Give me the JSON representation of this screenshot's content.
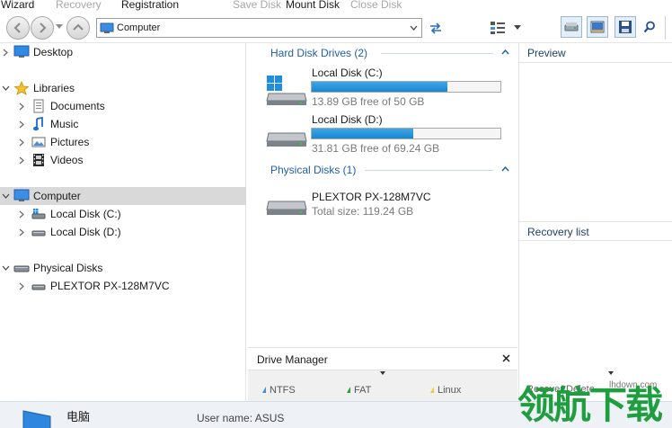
{
  "menu": [
    {
      "label": "Wizard",
      "enabled": true
    },
    {
      "label": "Recovery",
      "enabled": false
    },
    {
      "label": "Registration",
      "enabled": true
    },
    {
      "label": "Save Disk",
      "enabled": false
    },
    {
      "label": "Mount Disk",
      "enabled": true
    },
    {
      "label": "Close Disk",
      "enabled": false
    }
  ],
  "address": {
    "value": "Computer"
  },
  "tree": {
    "desktop": "Desktop",
    "libraries": "Libraries",
    "documents": "Documents",
    "music": "Music",
    "pictures": "Pictures",
    "videos": "Videos",
    "computer": "Computer",
    "disk_c": "Local Disk (C:)",
    "disk_d": "Local Disk (D:)",
    "physical_disks": "Physical Disks",
    "plextor": "PLEXTOR PX-128M7VC"
  },
  "hard_disk_group": {
    "title": "Hard Disk Drives (2)",
    "drives": [
      {
        "name": "Local Disk (C:)",
        "info": "13.89 GB free of 50 GB",
        "used_fraction": 0.72
      },
      {
        "name": "Local Disk (D:)",
        "info": "31.81 GB free of 69.24 GB",
        "used_fraction": 0.54
      }
    ]
  },
  "physical_group": {
    "title": "Physical Disks (1)",
    "disks": [
      {
        "name": "PLEXTOR PX-128M7VC",
        "info": "Total size: 119.24 GB"
      }
    ]
  },
  "drive_manager": {
    "title": "Drive Manager",
    "legend": [
      {
        "label": "NTFS",
        "color": "#3c8fd6"
      },
      {
        "label": "FAT",
        "color": "#2e9e3a"
      },
      {
        "label": "Linux",
        "color": "#e2d22a"
      }
    ]
  },
  "right_panel": {
    "preview": "Preview",
    "recovery_list": "Recovery list",
    "footer": "Recover    Delete"
  },
  "status": {
    "computer_name": "电脑",
    "user": "User name: ASUS"
  },
  "watermark": {
    "text": "领航下载",
    "url": "lhdown.com"
  }
}
